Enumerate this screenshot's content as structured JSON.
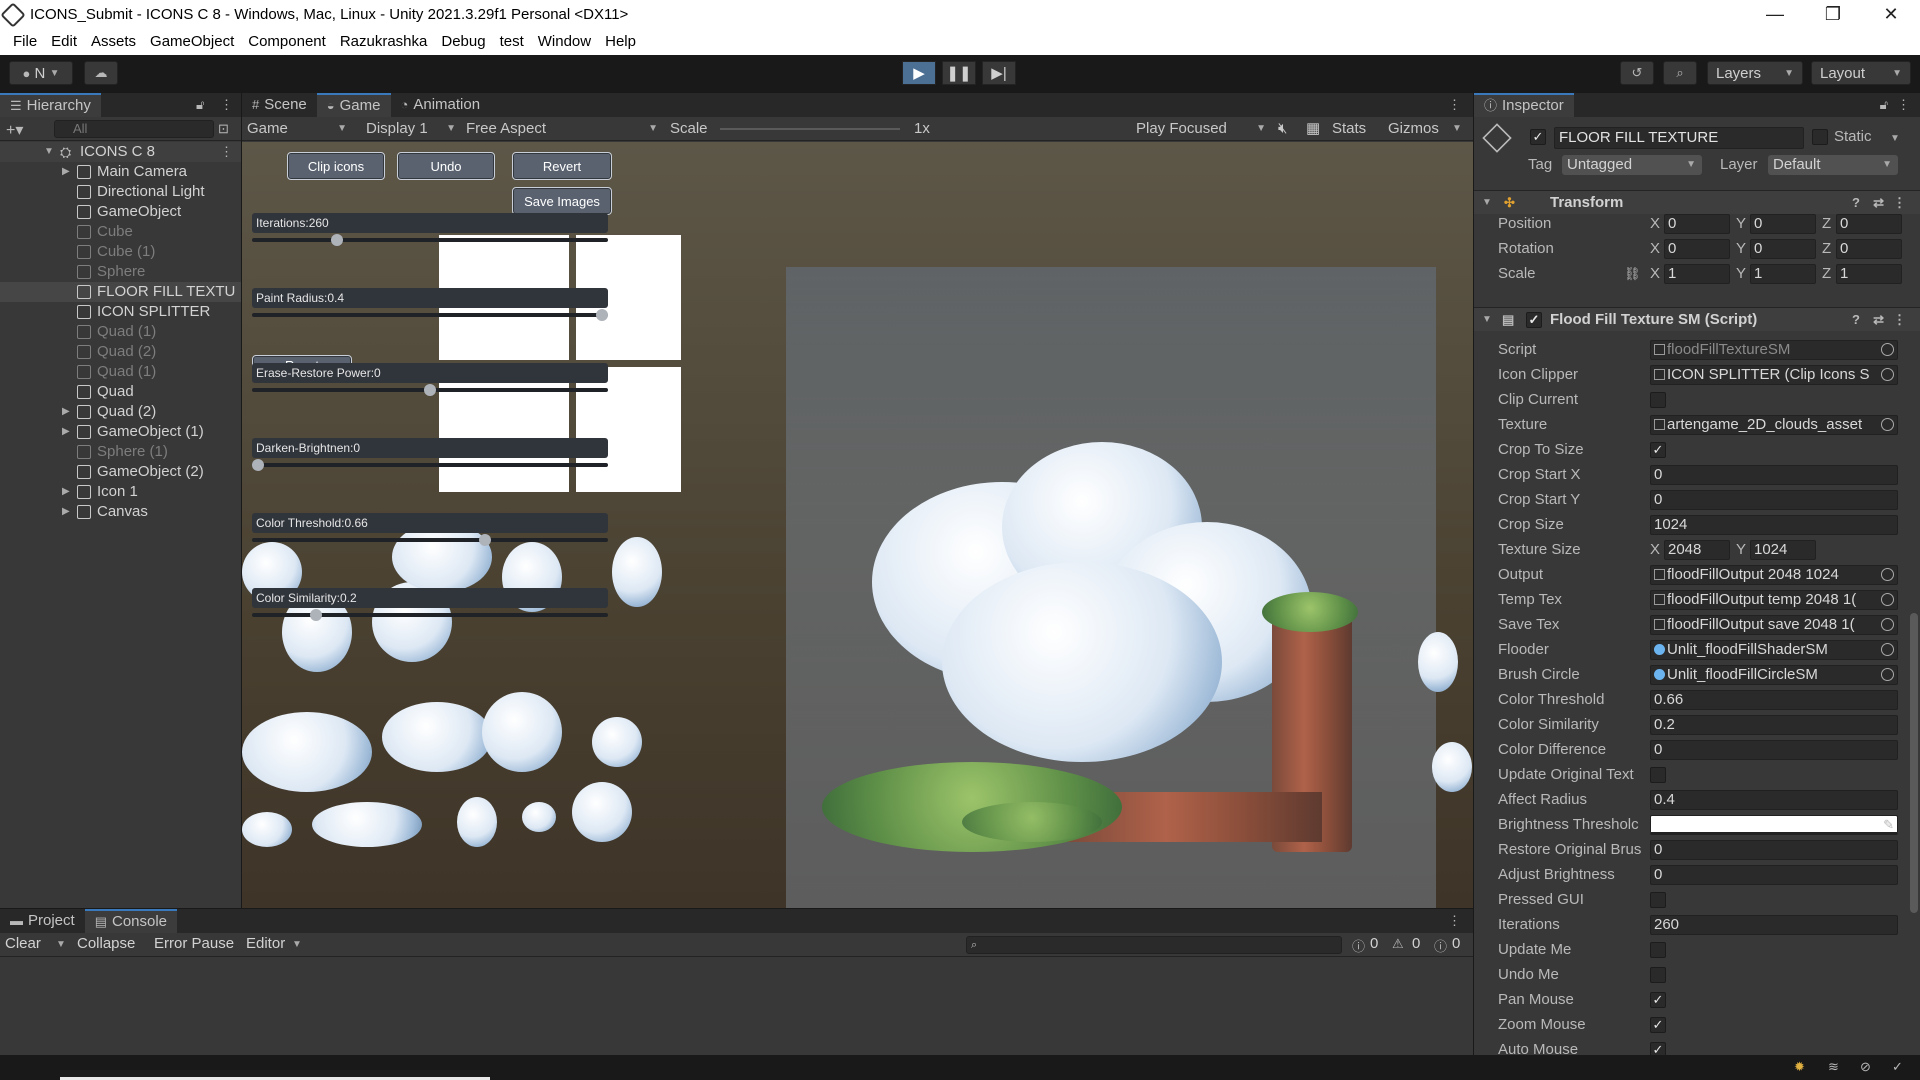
{
  "window": {
    "title": "ICONS_Submit - ICONS C 8 - Windows, Mac, Linux - Unity 2021.3.29f1 Personal <DX11>",
    "min": "—",
    "max": "❐",
    "close": "✕"
  },
  "menu": [
    "File",
    "Edit",
    "Assets",
    "GameObject",
    "Component",
    "Razukrashka",
    "Debug",
    "test",
    "Window",
    "Help"
  ],
  "toolbar": {
    "account": "N",
    "layers": "Layers",
    "layout": "Layout"
  },
  "hierarchy": {
    "tab": "Hierarchy",
    "search_placeholder": "All",
    "scene": "ICONS C 8",
    "items": [
      {
        "name": "Main Camera",
        "arrow": true,
        "dim": false
      },
      {
        "name": "Directional Light",
        "arrow": false,
        "dim": false
      },
      {
        "name": "GameObject",
        "arrow": false,
        "dim": false
      },
      {
        "name": "Cube",
        "arrow": false,
        "dim": true
      },
      {
        "name": "Cube (1)",
        "arrow": false,
        "dim": true
      },
      {
        "name": "Sphere",
        "arrow": false,
        "dim": true
      },
      {
        "name": "FLOOR FILL TEXTU",
        "arrow": false,
        "dim": false,
        "selected": true
      },
      {
        "name": "ICON SPLITTER",
        "arrow": false,
        "dim": false
      },
      {
        "name": "Quad (1)",
        "arrow": false,
        "dim": true
      },
      {
        "name": "Quad (2)",
        "arrow": false,
        "dim": true
      },
      {
        "name": "Quad (1)",
        "arrow": false,
        "dim": true
      },
      {
        "name": "Quad",
        "arrow": false,
        "dim": false
      },
      {
        "name": "Quad (2)",
        "arrow": true,
        "dim": false
      },
      {
        "name": "GameObject (1)",
        "arrow": true,
        "dim": false
      },
      {
        "name": "Sphere (1)",
        "arrow": false,
        "dim": true
      },
      {
        "name": "GameObject (2)",
        "arrow": false,
        "dim": false
      },
      {
        "name": "Icon 1",
        "arrow": true,
        "dim": false
      },
      {
        "name": "Canvas",
        "arrow": true,
        "dim": false
      }
    ]
  },
  "gameview": {
    "tabs": [
      "Scene",
      "Game",
      "Animation"
    ],
    "mode": "Game",
    "display": "Display 1",
    "aspect": "Free Aspect",
    "scale_label": "Scale",
    "scale_value": "1x",
    "play_focused": "Play Focused",
    "stats": "Stats",
    "gizmos": "Gizmos",
    "buttons": {
      "clip": "Clip icons",
      "undo": "Undo",
      "revert": "Revert",
      "save": "Save Images",
      "reset": "Reset"
    },
    "sliders": [
      {
        "label": "Iterations:260",
        "value": 0.23
      },
      {
        "label": "Paint Radius:0.4",
        "value": 1.0
      },
      {
        "label": "Erase-Restore Power:0",
        "value": 0.5
      },
      {
        "label": "Darken-Brightnen:0",
        "value": 0.0
      },
      {
        "label": "Color Threshold:0.66",
        "value": 0.66
      },
      {
        "label": "Color Similarity:0.2",
        "value": 0.17
      }
    ]
  },
  "inspector": {
    "tab": "Inspector",
    "object_name": "FLOOR FILL TEXTURE",
    "static": "Static",
    "tag_label": "Tag",
    "tag": "Untagged",
    "layer_label": "Layer",
    "layer": "Default",
    "transform": {
      "title": "Transform",
      "position": "Position",
      "rotation": "Rotation",
      "scale": "Scale",
      "pos": [
        "0",
        "0",
        "0"
      ],
      "rot": [
        "0",
        "0",
        "0"
      ],
      "scl": [
        "1",
        "1",
        "1"
      ]
    },
    "script_title": "Flood Fill Texture SM (Script)",
    "fields": [
      {
        "label": "Script",
        "type": "obj",
        "value": "floodFillTextureSM",
        "dim": true
      },
      {
        "label": "Icon Clipper",
        "type": "obj",
        "value": "ICON SPLITTER (Clip Icons S"
      },
      {
        "label": "Clip Current",
        "type": "bool",
        "value": false
      },
      {
        "label": "Texture",
        "type": "obj",
        "value": "artengame_2D_clouds_asset"
      },
      {
        "label": "Crop To Size",
        "type": "bool",
        "value": true
      },
      {
        "label": "Crop Start X",
        "type": "text",
        "value": "0"
      },
      {
        "label": "Crop Start Y",
        "type": "text",
        "value": "0"
      },
      {
        "label": "Crop Size",
        "type": "text",
        "value": "1024"
      },
      {
        "label": "Texture Size",
        "type": "xy",
        "x": "2048",
        "y": "1024"
      },
      {
        "label": "Output",
        "type": "obj",
        "value": "floodFillOutput 2048 1024"
      },
      {
        "label": "Temp Tex",
        "type": "obj",
        "value": "floodFillOutput temp 2048 1("
      },
      {
        "label": "Save Tex",
        "type": "obj",
        "value": "floodFillOutput save 2048 1("
      },
      {
        "label": "Flooder",
        "type": "mat",
        "value": "Unlit_floodFillShaderSM"
      },
      {
        "label": "Brush Circle",
        "type": "mat",
        "value": "Unlit_floodFillCircleSM"
      },
      {
        "label": "Color Threshold",
        "type": "text",
        "value": "0.66"
      },
      {
        "label": "Color Similarity",
        "type": "text",
        "value": "0.2"
      },
      {
        "label": "Color Difference",
        "type": "text",
        "value": "0"
      },
      {
        "label": "Update Original Text",
        "type": "bool",
        "value": false
      },
      {
        "label": "Affect Radius",
        "type": "text",
        "value": "0.4"
      },
      {
        "label": "Brightness Thresholc",
        "type": "color",
        "value": "#ffffff"
      },
      {
        "label": "Restore Original Brus",
        "type": "text",
        "value": "0"
      },
      {
        "label": "Adjust Brightness",
        "type": "text",
        "value": "0"
      },
      {
        "label": "Pressed GUI",
        "type": "bool",
        "value": false
      },
      {
        "label": "Iterations",
        "type": "text",
        "value": "260"
      },
      {
        "label": "Update Me",
        "type": "bool",
        "value": false
      },
      {
        "label": "Undo Me",
        "type": "bool",
        "value": false
      },
      {
        "label": "Pan Mouse",
        "type": "bool",
        "value": true
      },
      {
        "label": "Zoom Mouse",
        "type": "bool",
        "value": true
      },
      {
        "label": "Auto Mouse",
        "type": "bool",
        "value": true
      }
    ]
  },
  "console": {
    "tabs": [
      "Project",
      "Console"
    ],
    "clear": "Clear",
    "collapse": "Collapse",
    "error_pause": "Error Pause",
    "editor": "Editor",
    "log_count": "0",
    "warn_count": "0",
    "error_count": "0"
  }
}
